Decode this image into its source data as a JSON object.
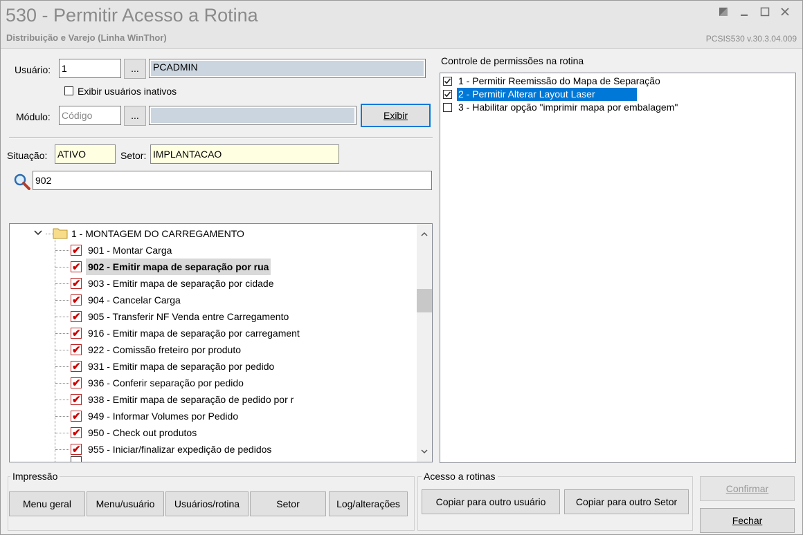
{
  "window": {
    "title": "530 - Permitir Acesso a Rotina",
    "subtitle": "Distribuição e Varejo (Linha WinThor)",
    "version": "PCSIS530  v.30.3.04.009"
  },
  "form": {
    "usuario_label": "Usuário:",
    "usuario_code": "1",
    "usuario_name": "PCADMIN",
    "lookup_label": "...",
    "exibir_inativos_label": "Exibir usuários inativos",
    "modulo_label": "Módulo:",
    "modulo_placeholder": "Código",
    "modulo_name": "",
    "exibir_button": "Exibir",
    "situacao_label": "Situação:",
    "situacao_value": "ATIVO",
    "setor_label": "Setor:",
    "setor_value": "IMPLANTACAO",
    "search_value": "902"
  },
  "tree": {
    "group_label": "1 - MONTAGEM DO CARREGAMENTO",
    "items": [
      {
        "label": "901 - Montar Carga",
        "checked": true
      },
      {
        "label": "902 - Emitir mapa de separação por rua",
        "checked": true,
        "highlight": true
      },
      {
        "label": "903 - Emitir mapa de separação por cidade",
        "checked": true
      },
      {
        "label": "904 - Cancelar Carga",
        "checked": true
      },
      {
        "label": "905 - Transferir NF Venda entre Carregamento",
        "checked": true
      },
      {
        "label": "916 - Emitir mapa de separação por carregament",
        "checked": true
      },
      {
        "label": "922 - Comissão freteiro por produto",
        "checked": true
      },
      {
        "label": "931 - Emitir mapa de separação por pedido",
        "checked": true
      },
      {
        "label": "936 - Conferir separação por pedido",
        "checked": true
      },
      {
        "label": "938 - Emitir mapa de separação de pedido por r",
        "checked": true
      },
      {
        "label": "949 - Informar Volumes por Pedido",
        "checked": true
      },
      {
        "label": "950 - Check out produtos",
        "checked": true
      },
      {
        "label": "955 - Iniciar/finalizar expedição de pedidos",
        "checked": true
      }
    ]
  },
  "permissions": {
    "title": "Controle de permissões na rotina",
    "items": [
      {
        "label": "1 - Permitir Reemissão do Mapa de Separação",
        "checked": true
      },
      {
        "label": "2 - Permitir Alterar Layout Laser",
        "checked": true,
        "selected": true
      },
      {
        "label": "3 - Habilitar opção \"imprimir mapa por embalagem\"",
        "checked": false
      }
    ]
  },
  "impressao": {
    "title": "Impressão",
    "buttons": [
      "Menu geral",
      "Menu/usuário",
      "Usuários/rotina",
      "Setor",
      "Log/alterações"
    ]
  },
  "acesso": {
    "title": "Acesso a rotinas",
    "copy_user": "Copiar para outro usuário",
    "copy_setor": "Copiar para outro Setor"
  },
  "actions": {
    "confirmar": "Confirmar",
    "fechar": "Fechar"
  }
}
